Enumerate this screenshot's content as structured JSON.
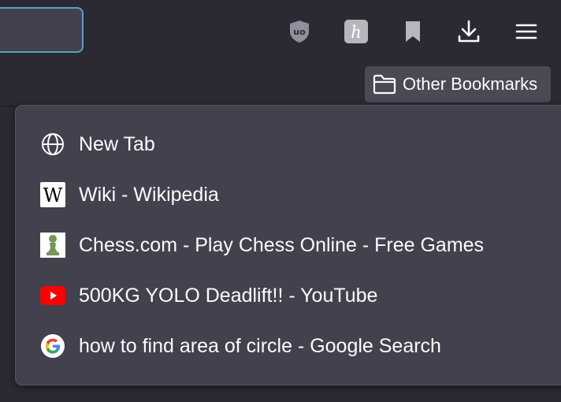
{
  "toolbar": {
    "icons": [
      "ublock-origin-icon",
      "honey-extension-icon",
      "bookmark-icon",
      "download-icon",
      "hamburger-menu-icon"
    ]
  },
  "bookmarks_bar": {
    "other_bookmarks_label": "Other Bookmarks"
  },
  "menu": {
    "items": [
      {
        "label": "New Tab",
        "icon": "globe-icon"
      },
      {
        "label": "Wiki - Wikipedia",
        "icon": "wikipedia-icon"
      },
      {
        "label": "Chess.com - Play Chess Online - Free Games",
        "icon": "chess-pawn-icon"
      },
      {
        "label": "500KG YOLO Deadlift!! - YouTube",
        "icon": "youtube-icon"
      },
      {
        "label": "how to find area of circle - Google Search",
        "icon": "google-icon"
      }
    ]
  },
  "colors": {
    "background": "#2b2a33",
    "panel": "#42414d",
    "text": "#fbfbfe",
    "focus_ring": "#5f9ec4",
    "youtube_red": "#ff0000",
    "chess_green": "#769656"
  }
}
